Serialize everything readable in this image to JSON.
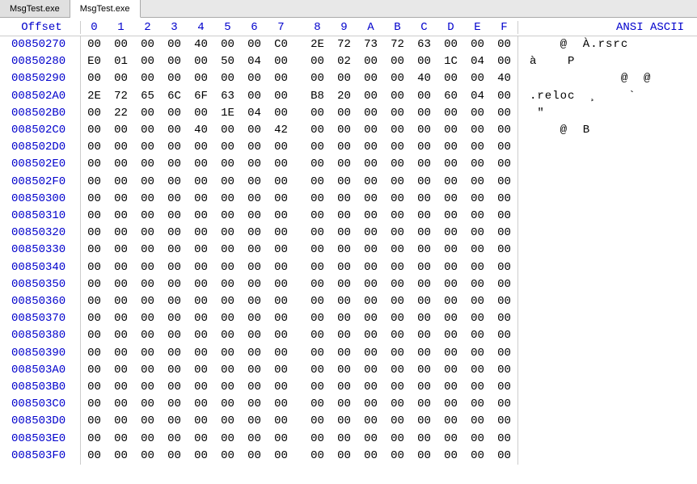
{
  "tabs": [
    {
      "label": "MsgTest.exe",
      "active": false
    },
    {
      "label": "MsgTest.exe",
      "active": true
    }
  ],
  "header": {
    "offset_label": "Offset",
    "byte_cols": [
      "0",
      "1",
      "2",
      "3",
      "4",
      "5",
      "6",
      "7",
      "8",
      "9",
      "A",
      "B",
      "C",
      "D",
      "E",
      "F"
    ],
    "ascii_label": "ANSI ASCII"
  },
  "rows": [
    {
      "offset": "00850270",
      "bytes": [
        "00",
        "00",
        "00",
        "00",
        "40",
        "00",
        "00",
        "C0",
        "2E",
        "72",
        "73",
        "72",
        "63",
        "00",
        "00",
        "00"
      ],
      "ascii": "    @  À.rsrc   "
    },
    {
      "offset": "00850280",
      "bytes": [
        "E0",
        "01",
        "00",
        "00",
        "00",
        "50",
        "04",
        "00",
        "00",
        "02",
        "00",
        "00",
        "00",
        "1C",
        "04",
        "00"
      ],
      "ascii": "à    P          "
    },
    {
      "offset": "00850290",
      "bytes": [
        "00",
        "00",
        "00",
        "00",
        "00",
        "00",
        "00",
        "00",
        "00",
        "00",
        "00",
        "00",
        "40",
        "00",
        "00",
        "40"
      ],
      "ascii": "            @  @"
    },
    {
      "offset": "008502A0",
      "bytes": [
        "2E",
        "72",
        "65",
        "6C",
        "6F",
        "63",
        "00",
        "00",
        "B8",
        "20",
        "00",
        "00",
        "00",
        "60",
        "04",
        "00"
      ],
      "ascii": ".reloc  ¸    `  "
    },
    {
      "offset": "008502B0",
      "bytes": [
        "00",
        "22",
        "00",
        "00",
        "00",
        "1E",
        "04",
        "00",
        "00",
        "00",
        "00",
        "00",
        "00",
        "00",
        "00",
        "00"
      ],
      "ascii": " \"              "
    },
    {
      "offset": "008502C0",
      "bytes": [
        "00",
        "00",
        "00",
        "00",
        "40",
        "00",
        "00",
        "42",
        "00",
        "00",
        "00",
        "00",
        "00",
        "00",
        "00",
        "00"
      ],
      "ascii": "    @  B        "
    },
    {
      "offset": "008502D0",
      "bytes": [
        "00",
        "00",
        "00",
        "00",
        "00",
        "00",
        "00",
        "00",
        "00",
        "00",
        "00",
        "00",
        "00",
        "00",
        "00",
        "00"
      ],
      "ascii": ""
    },
    {
      "offset": "008502E0",
      "bytes": [
        "00",
        "00",
        "00",
        "00",
        "00",
        "00",
        "00",
        "00",
        "00",
        "00",
        "00",
        "00",
        "00",
        "00",
        "00",
        "00"
      ],
      "ascii": ""
    },
    {
      "offset": "008502F0",
      "bytes": [
        "00",
        "00",
        "00",
        "00",
        "00",
        "00",
        "00",
        "00",
        "00",
        "00",
        "00",
        "00",
        "00",
        "00",
        "00",
        "00"
      ],
      "ascii": ""
    },
    {
      "offset": "00850300",
      "bytes": [
        "00",
        "00",
        "00",
        "00",
        "00",
        "00",
        "00",
        "00",
        "00",
        "00",
        "00",
        "00",
        "00",
        "00",
        "00",
        "00"
      ],
      "ascii": ""
    },
    {
      "offset": "00850310",
      "bytes": [
        "00",
        "00",
        "00",
        "00",
        "00",
        "00",
        "00",
        "00",
        "00",
        "00",
        "00",
        "00",
        "00",
        "00",
        "00",
        "00"
      ],
      "ascii": ""
    },
    {
      "offset": "00850320",
      "bytes": [
        "00",
        "00",
        "00",
        "00",
        "00",
        "00",
        "00",
        "00",
        "00",
        "00",
        "00",
        "00",
        "00",
        "00",
        "00",
        "00"
      ],
      "ascii": ""
    },
    {
      "offset": "00850330",
      "bytes": [
        "00",
        "00",
        "00",
        "00",
        "00",
        "00",
        "00",
        "00",
        "00",
        "00",
        "00",
        "00",
        "00",
        "00",
        "00",
        "00"
      ],
      "ascii": ""
    },
    {
      "offset": "00850340",
      "bytes": [
        "00",
        "00",
        "00",
        "00",
        "00",
        "00",
        "00",
        "00",
        "00",
        "00",
        "00",
        "00",
        "00",
        "00",
        "00",
        "00"
      ],
      "ascii": ""
    },
    {
      "offset": "00850350",
      "bytes": [
        "00",
        "00",
        "00",
        "00",
        "00",
        "00",
        "00",
        "00",
        "00",
        "00",
        "00",
        "00",
        "00",
        "00",
        "00",
        "00"
      ],
      "ascii": ""
    },
    {
      "offset": "00850360",
      "bytes": [
        "00",
        "00",
        "00",
        "00",
        "00",
        "00",
        "00",
        "00",
        "00",
        "00",
        "00",
        "00",
        "00",
        "00",
        "00",
        "00"
      ],
      "ascii": ""
    },
    {
      "offset": "00850370",
      "bytes": [
        "00",
        "00",
        "00",
        "00",
        "00",
        "00",
        "00",
        "00",
        "00",
        "00",
        "00",
        "00",
        "00",
        "00",
        "00",
        "00"
      ],
      "ascii": ""
    },
    {
      "offset": "00850380",
      "bytes": [
        "00",
        "00",
        "00",
        "00",
        "00",
        "00",
        "00",
        "00",
        "00",
        "00",
        "00",
        "00",
        "00",
        "00",
        "00",
        "00"
      ],
      "ascii": ""
    },
    {
      "offset": "00850390",
      "bytes": [
        "00",
        "00",
        "00",
        "00",
        "00",
        "00",
        "00",
        "00",
        "00",
        "00",
        "00",
        "00",
        "00",
        "00",
        "00",
        "00"
      ],
      "ascii": ""
    },
    {
      "offset": "008503A0",
      "bytes": [
        "00",
        "00",
        "00",
        "00",
        "00",
        "00",
        "00",
        "00",
        "00",
        "00",
        "00",
        "00",
        "00",
        "00",
        "00",
        "00"
      ],
      "ascii": ""
    },
    {
      "offset": "008503B0",
      "bytes": [
        "00",
        "00",
        "00",
        "00",
        "00",
        "00",
        "00",
        "00",
        "00",
        "00",
        "00",
        "00",
        "00",
        "00",
        "00",
        "00"
      ],
      "ascii": ""
    },
    {
      "offset": "008503C0",
      "bytes": [
        "00",
        "00",
        "00",
        "00",
        "00",
        "00",
        "00",
        "00",
        "00",
        "00",
        "00",
        "00",
        "00",
        "00",
        "00",
        "00"
      ],
      "ascii": ""
    },
    {
      "offset": "008503D0",
      "bytes": [
        "00",
        "00",
        "00",
        "00",
        "00",
        "00",
        "00",
        "00",
        "00",
        "00",
        "00",
        "00",
        "00",
        "00",
        "00",
        "00"
      ],
      "ascii": ""
    },
    {
      "offset": "008503E0",
      "bytes": [
        "00",
        "00",
        "00",
        "00",
        "00",
        "00",
        "00",
        "00",
        "00",
        "00",
        "00",
        "00",
        "00",
        "00",
        "00",
        "00"
      ],
      "ascii": ""
    },
    {
      "offset": "008503F0",
      "bytes": [
        "00",
        "00",
        "00",
        "00",
        "00",
        "00",
        "00",
        "00",
        "00",
        "00",
        "00",
        "00",
        "00",
        "00",
        "00",
        "00"
      ],
      "ascii": ""
    }
  ]
}
